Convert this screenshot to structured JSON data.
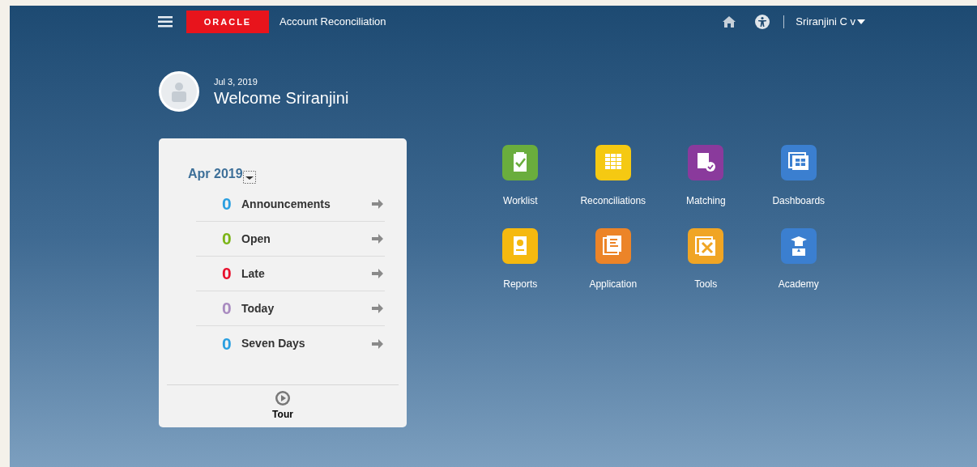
{
  "header": {
    "logo": "ORACLE",
    "app_title": "Account Reconciliation",
    "user": "Sriranjini C v"
  },
  "welcome": {
    "date": "Jul 3, 2019",
    "greeting": "Welcome Sriranjini"
  },
  "summary": {
    "period": "Apr 2019",
    "items": [
      {
        "count": "0",
        "label": "Announcements",
        "color": "#2a9fe0"
      },
      {
        "count": "0",
        "label": "Open",
        "color": "#7cb518"
      },
      {
        "count": "0",
        "label": "Late",
        "color": "#e8112d"
      },
      {
        "count": "0",
        "label": "Today",
        "color": "#a98bc0"
      },
      {
        "count": "0",
        "label": "Seven Days",
        "color": "#2a9fe0"
      }
    ],
    "tour": "Tour"
  },
  "tiles": [
    {
      "label": "Worklist",
      "color": "#6aad3d"
    },
    {
      "label": "Reconciliations",
      "color": "#f5c912"
    },
    {
      "label": "Matching",
      "color": "#8a3a9c"
    },
    {
      "label": "Dashboards",
      "color": "#3b7fd0"
    },
    {
      "label": "Reports",
      "color": "#f5b90f"
    },
    {
      "label": "Application",
      "color": "#ec8428"
    },
    {
      "label": "Tools",
      "color": "#f0a524"
    },
    {
      "label": "Academy",
      "color": "#3b7fd0"
    }
  ]
}
